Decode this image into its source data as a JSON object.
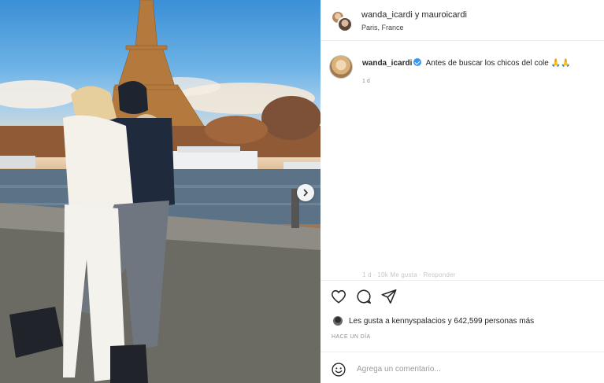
{
  "post": {
    "header": {
      "usernames": "wanda_icardi y mauroicardi",
      "location": "Paris, France"
    },
    "caption": {
      "username": "wanda_icardi",
      "text": "Antes de buscar los chicos del cole",
      "emoji": "🙏🙏",
      "time": "1 d"
    },
    "faint_line": "1 d · 10k Me gusta · Responder",
    "actions": {
      "like_icon": "heart-icon",
      "comment_icon": "comment-icon",
      "share_icon": "share-icon"
    },
    "likes": {
      "text": "Les gusta a kennyspalacios y 642,599 personas más"
    },
    "age": "HACE UN DÍA",
    "add_comment": {
      "placeholder": "Agrega un comentario..."
    }
  },
  "colors": {
    "verified": "#3897f0",
    "border": "#efefef",
    "muted": "#8e8e8e"
  }
}
